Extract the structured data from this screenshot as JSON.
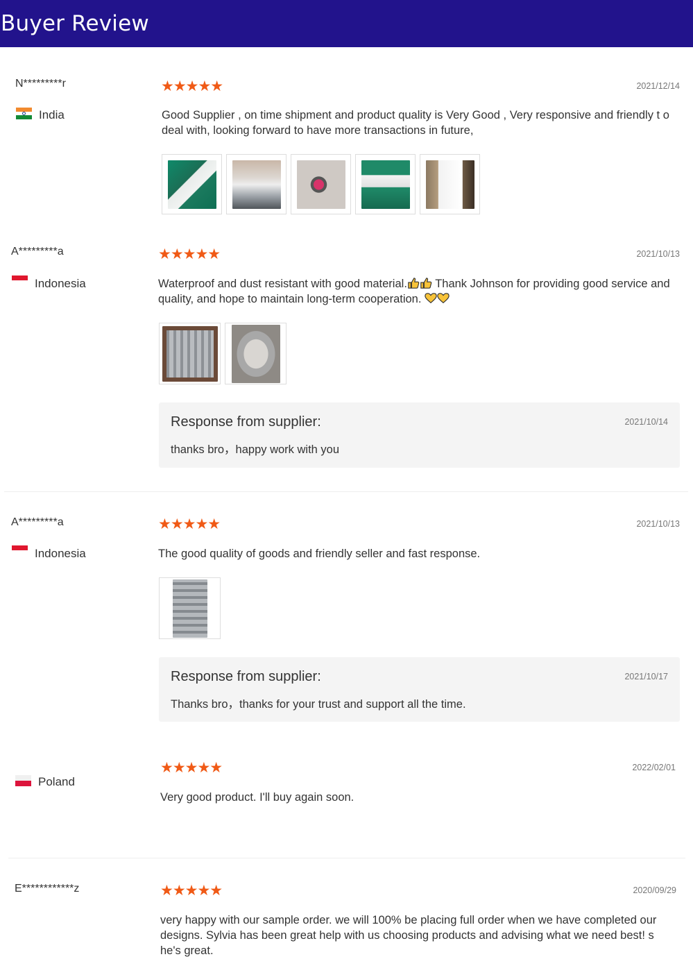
{
  "page_title": "Buyer Review",
  "star_glyphs": "★★★★★",
  "colors": {
    "header_bg": "#22138c",
    "star": "#f05a16",
    "response_bg": "#f4f4f4"
  },
  "reviews": [
    {
      "buyer": "N*********r",
      "country": "India",
      "flag": "india-flag",
      "rating": 5,
      "date": "2021/12/14",
      "text": "Good Supplier , on time shipment and product quality is Very Good , Very responsive and friendly t o deal with, looking forward to have more transactions in future,",
      "images": [
        "product-photo-1",
        "product-photo-2",
        "product-photo-3",
        "product-photo-4",
        "product-photo-5"
      ]
    },
    {
      "buyer": "A*********a",
      "country": "Indonesia",
      "flag": "indonesia-flag",
      "rating": 5,
      "date": "2021/10/13",
      "text_part1": "Waterproof and dust resistant with good material.",
      "text_part2": " Thank Johnson for providing good service and quality, and hope to maintain long-term cooperation. ",
      "images": [
        "enclosure-photo-1",
        "enclosure-photo-2"
      ],
      "response": {
        "title": "Response from supplier:",
        "date": "2021/10/14",
        "text": "thanks bro，happy work with you"
      }
    },
    {
      "buyer": "A*********a",
      "country": "Indonesia",
      "flag": "indonesia-flag",
      "rating": 5,
      "date": "2021/10/13",
      "text": "The good quality of goods and friendly seller and fast response.",
      "images": [
        "enclosure-photo-3"
      ],
      "response": {
        "title": "Response from supplier:",
        "date": "2021/10/17",
        "text": "Thanks bro，thanks for your trust and support all the time."
      }
    },
    {
      "buyer": "",
      "country": "Poland",
      "flag": "poland-flag",
      "rating": 5,
      "date": "2022/02/01",
      "text": "Very good product. I'll buy again soon."
    },
    {
      "buyer": "E************z",
      "country": "",
      "rating": 5,
      "date": "2020/09/29",
      "text": "very happy with our sample order. we will 100% be placing full order when we have completed our designs. Sylvia has been great help with us choosing products and advising what we need best! s he's great."
    }
  ]
}
